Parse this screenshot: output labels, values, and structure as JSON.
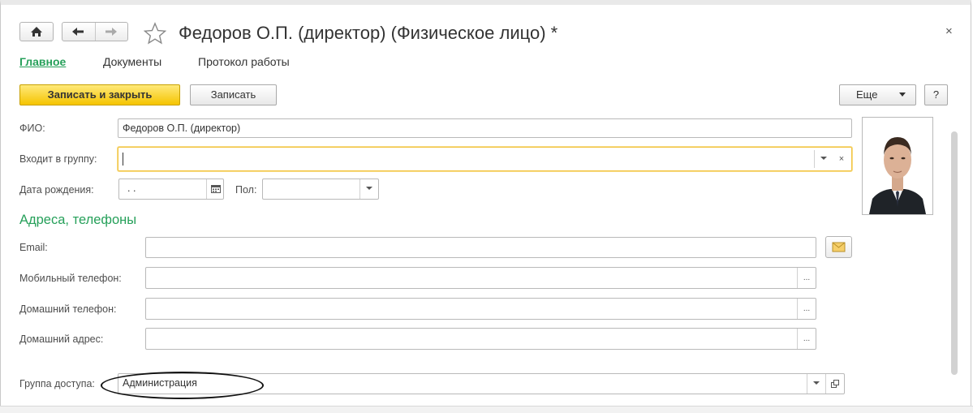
{
  "window": {
    "title": "Федоров О.П. (директор) (Физическое лицо) *",
    "close_glyph": "×"
  },
  "nav": {
    "home_icon": "home-icon",
    "back_icon": "arrow-left-icon",
    "forward_icon": "arrow-right-icon",
    "favorite_icon": "star-icon"
  },
  "tabs": [
    {
      "label": "Главное",
      "active": true
    },
    {
      "label": "Документы",
      "active": false
    },
    {
      "label": "Протокол работы",
      "active": false
    }
  ],
  "toolbar": {
    "save_close_label": "Записать и закрыть",
    "save_label": "Записать",
    "more_label": "Еще",
    "help_label": "?"
  },
  "form": {
    "fio_label": "ФИО:",
    "fio_value": "Федоров О.П. (директор)",
    "group_label": "Входит в группу:",
    "group_value": "",
    "birth_label": "Дата рождения:",
    "birth_value": ".  .",
    "gender_label": "Пол:",
    "gender_value": "",
    "section_title": "Адреса, телефоны",
    "email_label": "Email:",
    "email_value": "",
    "mobile_label": "Мобильный телефон:",
    "mobile_value": "",
    "home_phone_label": "Домашний телефон:",
    "home_phone_value": "",
    "home_address_label": "Домашний адрес:",
    "home_address_value": "",
    "access_group_label": "Группа доступа:",
    "access_group_value": "Администрация",
    "ellipsis": "..."
  },
  "colors": {
    "accent_green": "#26a05a",
    "primary_button": "#f5c400",
    "focus_border": "#f2c341"
  }
}
